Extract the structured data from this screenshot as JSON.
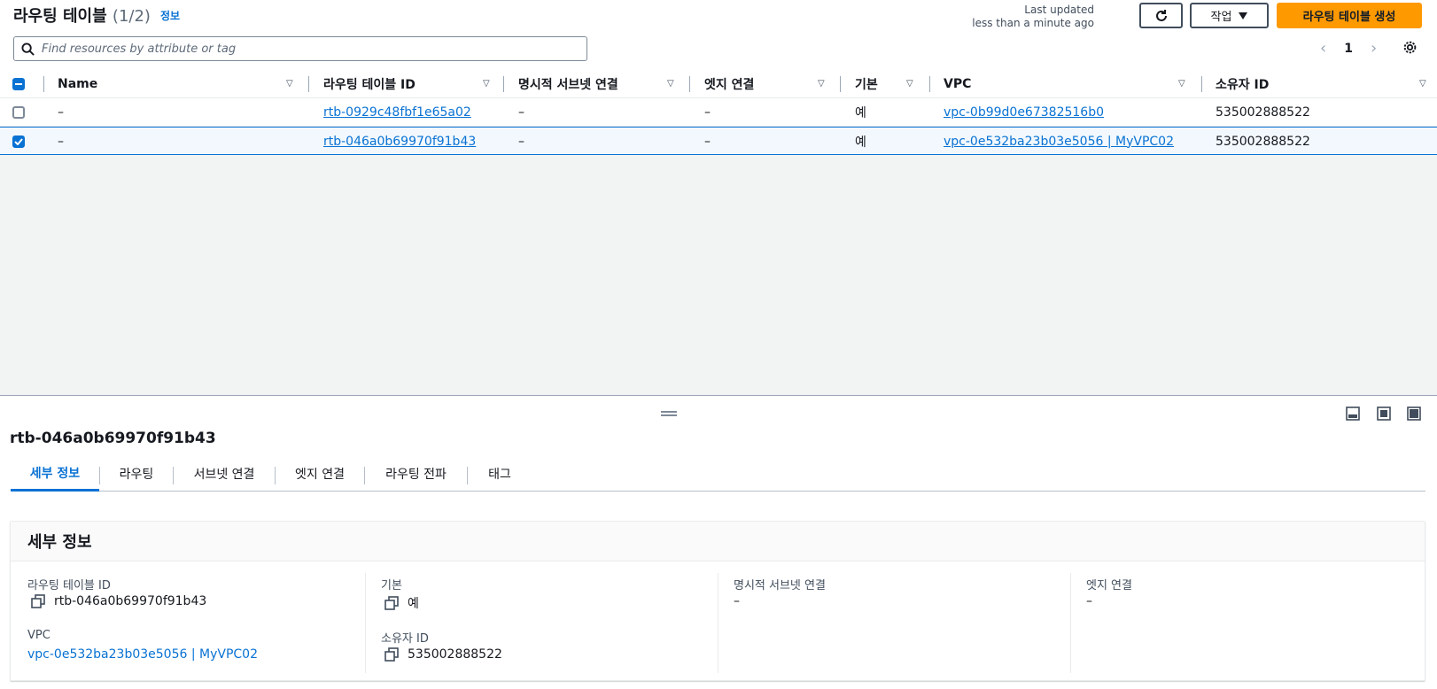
{
  "header": {
    "title": "라우팅 테이블",
    "count": "(1/2)",
    "info": "정보",
    "last_updated_label": "Last updated",
    "last_updated_value": "less than a minute ago",
    "actions_label": "작업",
    "create_label": "라우팅 테이블 생성"
  },
  "search": {
    "placeholder": "Find resources by attribute or tag"
  },
  "pagination": {
    "current_page": "1"
  },
  "table": {
    "columns": [
      "Name",
      "라우팅 테이블 ID",
      "명시적 서브넷 연결",
      "엣지 연결",
      "기본",
      "VPC",
      "소유자 ID"
    ],
    "rows": [
      {
        "selected": false,
        "name": "–",
        "rtb_id": "rtb-0929c48fbf1e65a02",
        "subnet_assoc": "–",
        "edge_assoc": "–",
        "main": "예",
        "vpc": "vpc-0b99d0e67382516b0",
        "owner": "535002888522"
      },
      {
        "selected": true,
        "name": "–",
        "rtb_id": "rtb-046a0b69970f91b43",
        "subnet_assoc": "–",
        "edge_assoc": "–",
        "main": "예",
        "vpc": "vpc-0e532ba23b03e5056 | MyVPC02",
        "owner": "535002888522"
      }
    ]
  },
  "split_panel": {
    "title": "rtb-046a0b69970f91b43",
    "tabs": [
      "세부 정보",
      "라우팅",
      "서브넷 연결",
      "엣지 연결",
      "라우팅 전파",
      "태그"
    ],
    "active_tab": 0,
    "details": {
      "heading": "세부 정보",
      "rtb_id_label": "라우팅 테이블 ID",
      "rtb_id_value": "rtb-046a0b69970f91b43",
      "main_label": "기본",
      "main_value": "예",
      "subnet_label": "명시적 서브넷 연결",
      "subnet_value": "–",
      "edge_label": "엣지 연결",
      "edge_value": "–",
      "vpc_label": "VPC",
      "vpc_value": "vpc-0e532ba23b03e5056 | MyVPC02",
      "owner_label": "소유자 ID",
      "owner_value": "535002888522"
    }
  },
  "colors": {
    "accent": "#0972d3",
    "primary_button": "#ff9900",
    "empty_area": "#f2f3f3"
  }
}
